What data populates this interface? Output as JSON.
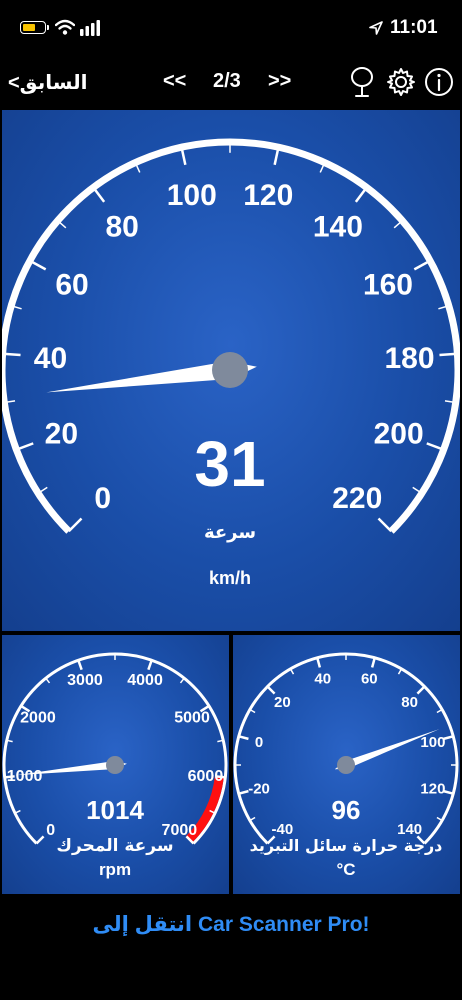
{
  "status_bar": {
    "time": "11:01",
    "battery_level": 0.55,
    "battery_color": "#f7c300"
  },
  "nav": {
    "back_label": "السابق>",
    "prev_label": "<<",
    "page": "2/3",
    "next_label": ">>",
    "icons": [
      "mic-icon",
      "gear-icon",
      "info-icon"
    ]
  },
  "speed": {
    "value": "31",
    "label": "سرعة",
    "unit": "km/h",
    "min": 0,
    "max": 220,
    "ticks": [
      "0",
      "20",
      "40",
      "60",
      "80",
      "100",
      "120",
      "140",
      "160",
      "180",
      "200",
      "220"
    ]
  },
  "rpm": {
    "value": "1014",
    "label": "سرعة المحرك",
    "unit": "rpm",
    "min": 0,
    "max": 7000,
    "redline_start": 6000,
    "ticks": [
      "0",
      "1000",
      "2000",
      "3000",
      "4000",
      "5000",
      "6000",
      "7000"
    ]
  },
  "temp": {
    "value": "96",
    "label": "درجة حرارة سائل التبريد",
    "unit": "°C",
    "min": -40,
    "max": 140,
    "ticks": [
      "-40",
      "-20",
      "0",
      "20",
      "40",
      "60",
      "80",
      "100",
      "120",
      "140"
    ]
  },
  "promo": {
    "text": "!Car Scanner Pro انتقل إلى",
    "color": "#2f8cf5"
  }
}
